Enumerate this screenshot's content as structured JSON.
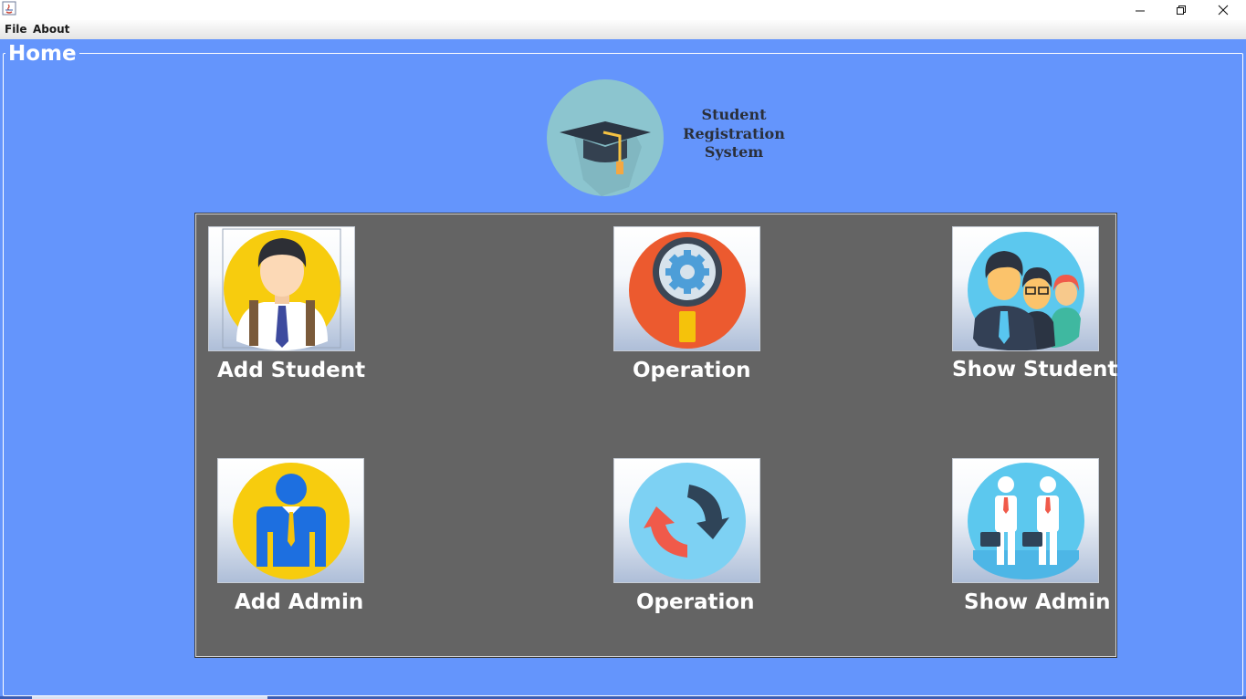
{
  "menu": {
    "file": "File",
    "about": "About"
  },
  "frame": {
    "title": "Home"
  },
  "logo": {
    "icon": "graduation-cap-icon",
    "line1": "Student",
    "line2": "Registration",
    "line3": "System"
  },
  "tiles": [
    {
      "label": "Add Student",
      "icon": "student-icon"
    },
    {
      "label": "Operation",
      "icon": "search-gear-icon"
    },
    {
      "label": "Show Student",
      "icon": "students-group-icon"
    },
    {
      "label": "Add Admin",
      "icon": "admin-icon"
    },
    {
      "label": "Operation",
      "icon": "refresh-arrows-icon"
    },
    {
      "label": "Show Admin",
      "icon": "admins-group-icon"
    }
  ],
  "colors": {
    "background": "#6495fc",
    "panel": "#646464",
    "title_bar": "#ffffff"
  }
}
